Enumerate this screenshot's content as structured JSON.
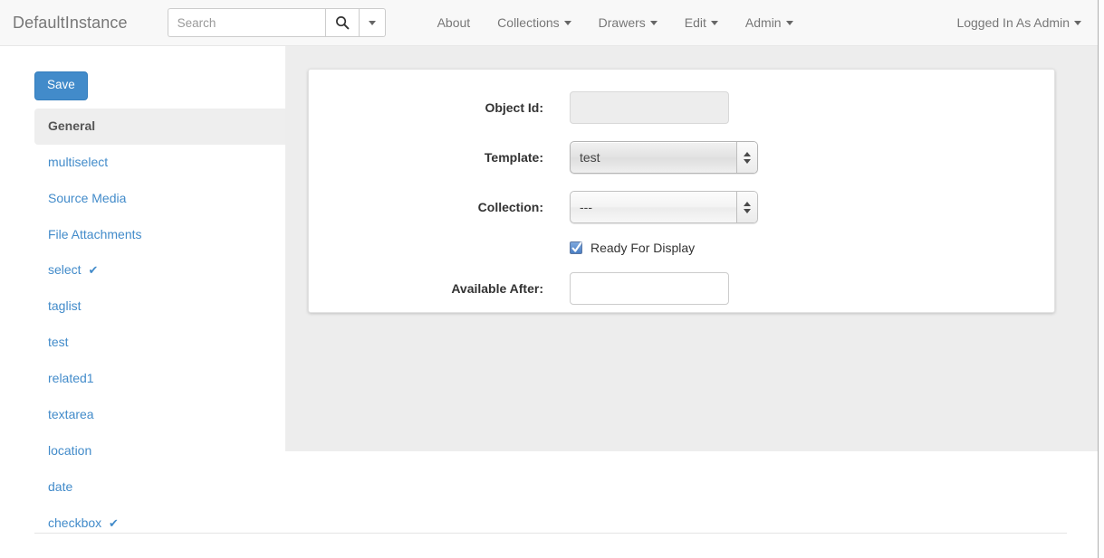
{
  "navbar": {
    "brand": "DefaultInstance",
    "search": {
      "placeholder": "Search",
      "value": "",
      "search_icon": "search-icon",
      "caret_icon": "chevron-down-icon"
    },
    "links": [
      {
        "label": "About",
        "has_caret": false
      },
      {
        "label": "Collections",
        "has_caret": true
      },
      {
        "label": "Drawers",
        "has_caret": true
      },
      {
        "label": "Edit",
        "has_caret": true
      },
      {
        "label": "Admin",
        "has_caret": true
      }
    ],
    "user_menu": {
      "label": "Logged In As Admin",
      "has_caret": true
    }
  },
  "sidebar": {
    "save_label": "Save",
    "items": [
      {
        "label": "General",
        "active": true,
        "check": ""
      },
      {
        "label": "multiselect",
        "active": false,
        "check": ""
      },
      {
        "label": "Source Media",
        "active": false,
        "check": ""
      },
      {
        "label": "File Attachments",
        "active": false,
        "check": ""
      },
      {
        "label": "select",
        "active": false,
        "check": "✔"
      },
      {
        "label": "taglist",
        "active": false,
        "check": ""
      },
      {
        "label": "test",
        "active": false,
        "check": ""
      },
      {
        "label": "related1",
        "active": false,
        "check": ""
      },
      {
        "label": "textarea",
        "active": false,
        "check": ""
      },
      {
        "label": "location",
        "active": false,
        "check": ""
      },
      {
        "label": "date",
        "active": false,
        "check": ""
      },
      {
        "label": "checkbox",
        "active": false,
        "check": "✔"
      }
    ]
  },
  "form": {
    "object_id": {
      "label": "Object Id:",
      "value": "",
      "disabled": true
    },
    "template": {
      "label": "Template:",
      "value": "test"
    },
    "collection": {
      "label": "Collection:",
      "value": "---"
    },
    "ready_for_display": {
      "label": "Ready For Display",
      "checked": true
    },
    "available_after": {
      "label": "Available After:",
      "value": "",
      "placeholder": ""
    }
  },
  "colors": {
    "primary": "#428bca",
    "link": "#428bca",
    "content_bg": "#ededed",
    "navbar_bg": "#f8f8f8"
  }
}
